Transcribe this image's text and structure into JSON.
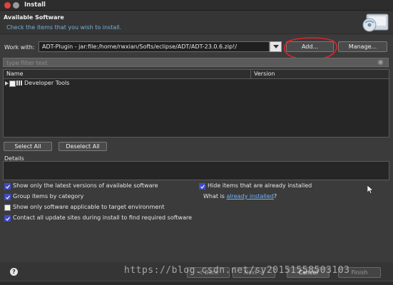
{
  "window": {
    "title": "Install"
  },
  "header": {
    "title": "Available Software",
    "subtitle": "Check the items that you wish to install.",
    "icon": "cd-install-icon"
  },
  "work_with": {
    "label": "Work with:",
    "value": "ADT-Plugin - jar:file:/home/rwxian/Softs/eclipse/ADT/ADT-23.0.6.zip!/",
    "add_label": "Add...",
    "manage_label": "Manage..."
  },
  "filter": {
    "placeholder": "type filter text"
  },
  "table": {
    "columns": [
      "Name",
      "Version"
    ],
    "rows": [
      {
        "name": "Developer Tools",
        "version": ""
      }
    ]
  },
  "selection": {
    "select_all": "Select All",
    "deselect_all": "Deselect All"
  },
  "details": {
    "label": "Details"
  },
  "options": {
    "latest_versions": {
      "label": "Show only the latest versions of available software",
      "checked": true
    },
    "group_by_category": {
      "label": "Group items by category",
      "checked": true
    },
    "target_env": {
      "label": "Show only software applicable to target environment",
      "checked": false
    },
    "contact_sites": {
      "label": "Contact all update sites during install to find required software",
      "checked": true
    },
    "hide_installed": {
      "label": "Hide items that are already installed",
      "checked": true
    },
    "what_is": {
      "prefix": "What is ",
      "link": "already installed",
      "suffix": "?"
    }
  },
  "footer": {
    "back": "< Back",
    "next": "Next >",
    "cancel": "Cancel",
    "finish": "Finish",
    "watermark": "https://blog.csdn.net/sy20151558503103"
  },
  "colors": {
    "annotation": "#e0242b",
    "link": "#6fb4ff",
    "checkbox": "#3e4cc7"
  }
}
